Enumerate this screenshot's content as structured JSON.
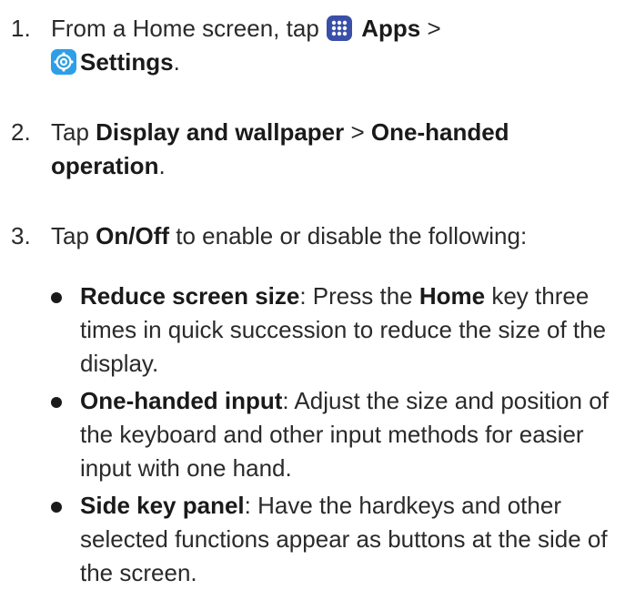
{
  "steps": [
    {
      "number": "1.",
      "line1_prefix": "From a Home screen, tap ",
      "apps_icon": "apps-grid-icon",
      "apps_label": "Apps",
      "line1_sep": " >",
      "settings_icon": "settings-gear-icon",
      "settings_label": "Settings",
      "line2_suffix": "."
    },
    {
      "number": "2.",
      "prefix": "Tap ",
      "term1": "Display and wallpaper",
      "sep": " > ",
      "term2": "One-handed operation",
      "suffix": "."
    },
    {
      "number": "3.",
      "prefix": "Tap ",
      "term": "On/Off",
      "suffix": " to enable or disable the following:"
    }
  ],
  "bullets": [
    {
      "term": "Reduce screen size",
      "text_a": ": Press the ",
      "term_b": "Home",
      "text_b": " key three times in quick succession to reduce the size of the display."
    },
    {
      "term": "One-handed input",
      "text": ": Adjust the size and position of the keyboard and other input methods for easier input with one hand."
    },
    {
      "term": "Side key panel",
      "text": ": Have the hardkeys and other selected functions appear as buttons at the side of the screen."
    }
  ],
  "colors": {
    "text": "#2a2a2a",
    "apps_icon_bg": "#3a4fa8",
    "settings_icon_bg": "#2e9fe6"
  }
}
